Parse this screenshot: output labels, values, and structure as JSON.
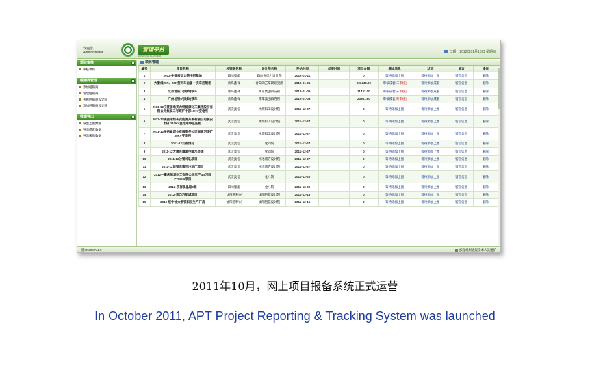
{
  "header": {
    "welcome_line1": "欢迎您,",
    "welcome_line2": "Administrator",
    "logo_title": "管理平台",
    "logo_subtitle": "SUPERVISE PLATFORM",
    "date_text": "日期：2012年01月18日 星期三"
  },
  "sidebar": {
    "groups": [
      {
        "title": "项目审核",
        "items": [
          "审核项目"
        ]
      },
      {
        "title": "经销商管理",
        "items": [
          "添加经销商",
          "管理经销商",
          "查看经销商设计院",
          "添加经销商设计院"
        ]
      },
      {
        "title": "数据导出",
        "items": [
          "导出上图数据",
          "导出成套数据",
          "导出采购数据"
        ]
      }
    ]
  },
  "main": {
    "panel_title": "项目管理",
    "columns": [
      "编号",
      "项目名称",
      "经销商名称",
      "设计院名称",
      "开始时间",
      "结束时间",
      "项目金额",
      "基本信息",
      "状态",
      "留言",
      "操作"
    ],
    "rows": [
      {
        "no": "1",
        "name": "2012-中国核动力院中阿基地",
        "dealer": "四川蜀能",
        "institute": "四川省电力设计院",
        "start": "2012-01-11",
        "end": "",
        "amount": "0",
        "info": "等待添加上图",
        "status": "等待添加上图",
        "message": "留言信息",
        "op": "删除",
        "marked": false
      },
      {
        "no": "2",
        "name": "大秦线25T、25K型列车自备一次车控制柜",
        "dealer": "青岛鑫祥",
        "institute": "青岛四方车辆研究所",
        "start": "2012-01-06",
        "end": "",
        "amount": "237440.00",
        "info": "审核成套",
        "info_tag": "[未审核]",
        "status": "等待添加成套",
        "message": "留言信息",
        "op": "删除",
        "marked": true
      },
      {
        "no": "3",
        "name": "北京地铁1号线地铁车",
        "dealer": "青岛鑫祥",
        "institute": "南车集团四方所",
        "start": "2012-01-06",
        "end": "",
        "amount": "11433.00",
        "info": "审核成套",
        "info_tag": "[未审核]",
        "status": "等待添加成套",
        "message": "留言信息",
        "op": "删除",
        "marked": true
      },
      {
        "no": "4",
        "name": "广州地铁5号线地铁车",
        "dealer": "青岛鑫祥",
        "institute": "南车集团四方所",
        "start": "2012-01-06",
        "end": "",
        "amount": "23561.60",
        "info": "审核成套",
        "info_tag": "[未审核]",
        "status": "等待添加成套",
        "message": "留言信息",
        "op": "删除",
        "marked": true
      },
      {
        "no": "5",
        "name": "2011-12宁夏国电英力特能源化工集团股份有限公司焦炭二号煤矿中部10KV变电所",
        "dealer": "武汉奥信",
        "institute": "中煤科工设计院",
        "start": "2011-12-27",
        "end": "",
        "amount": "0",
        "info": "等待添加上图",
        "status": "等待添加上图",
        "message": "留言信息",
        "op": "删除",
        "marked": false
      },
      {
        "no": "6",
        "name": "2011-12陕西中煤长安能源开发有限公司长安煤矿110KV变电所中低压柜",
        "dealer": "武汉奥信",
        "institute": "中煤科工设计院",
        "start": "2011-12-27",
        "end": "",
        "amount": "0",
        "info": "等待添加上图",
        "status": "等待添加上图",
        "message": "留言信息",
        "op": "删除",
        "marked": false
      },
      {
        "no": "7",
        "name": "2011-12陕西省煤业有限责任公司涧家河煤矿35KV变电所",
        "dealer": "武汉奥信",
        "institute": "中煤科工设计院",
        "start": "2011-12-27",
        "end": "",
        "amount": "0",
        "info": "等待添加上图",
        "status": "等待添加上图",
        "message": "留言信息",
        "op": "删除",
        "marked": false
      },
      {
        "no": "8",
        "name": "2011-12云南煤化",
        "dealer": "武汉奥信",
        "institute": "化四院",
        "start": "2011-12-27",
        "end": "",
        "amount": "0",
        "info": "等待添加上图",
        "status": "等待添加上图",
        "message": "留言信息",
        "op": "删除",
        "marked": false
      },
      {
        "no": "9",
        "name": "2011-12大唐克旗苯甲酸水处理",
        "dealer": "武汉奥信",
        "institute": "化四院",
        "start": "2011-12-27",
        "end": "",
        "amount": "0",
        "info": "等待添加上图",
        "status": "等待添加上图",
        "message": "留言信息",
        "op": "删除",
        "marked": false
      },
      {
        "no": "10",
        "name": "2011-12沙钢冷轧项目",
        "dealer": "武汉奥信",
        "institute": "中冶南方设计院",
        "start": "2011-12-27",
        "end": "",
        "amount": "0",
        "info": "等待添加上图",
        "status": "等待添加上图",
        "message": "留言信息",
        "op": "删除",
        "marked": false
      },
      {
        "no": "11",
        "name": "2011-12首钢京唐三冷轧厂项目",
        "dealer": "武汉奥信",
        "institute": "中冶南方设计院",
        "start": "2011-12-27",
        "end": "",
        "amount": "0",
        "info": "等待添加上图",
        "status": "等待添加上图",
        "message": "留言信息",
        "op": "删除",
        "marked": false
      },
      {
        "no": "12",
        "name": "2012—重庆施湘化工有限公司年产4.8万吨PTMEG项目",
        "dealer": "武汉奥信",
        "institute": "化八院",
        "start": "2011-12-20",
        "end": "",
        "amount": "0",
        "info": "等待添加上图",
        "status": "等待添加上图",
        "message": "留言信息",
        "op": "删除",
        "marked": false
      },
      {
        "no": "13",
        "name": "2012-永祥多晶硅3期",
        "dealer": "四川蜀能",
        "institute": "化八院",
        "start": "2011-12-20",
        "end": "",
        "amount": "0",
        "info": "等待添加上图",
        "status": "等待添加上图",
        "message": "留言信息",
        "op": "删除",
        "marked": false
      },
      {
        "no": "14",
        "name": "2012-营口汽配城项目",
        "dealer": "沈阳道利兴",
        "institute": "沈阳铝镁设计院",
        "start": "2011-12-16",
        "end": "",
        "amount": "0",
        "info": "等待添加上图",
        "status": "等待添加上图",
        "message": "留言信息",
        "op": "删除",
        "marked": false
      },
      {
        "no": "15",
        "name": "2012-绥中沈大钢铁科技生产厂房",
        "dealer": "沈阳道利兴",
        "institute": "沈阳铝镁设计院",
        "start": "2011-12-16",
        "end": "",
        "amount": "0",
        "info": "等待添加上图",
        "status": "等待添加上图",
        "message": "留言信息",
        "op": "删除",
        "marked": false
      }
    ]
  },
  "status_bar": {
    "left": "版本 2009V1.0",
    "right": "加强规划通报技术人员维护"
  },
  "captions": {
    "zh": "2011年10月，网上项目报备系统正式运营",
    "en": "In October 2011, APT Project Reporting & Tracking System was launched"
  }
}
